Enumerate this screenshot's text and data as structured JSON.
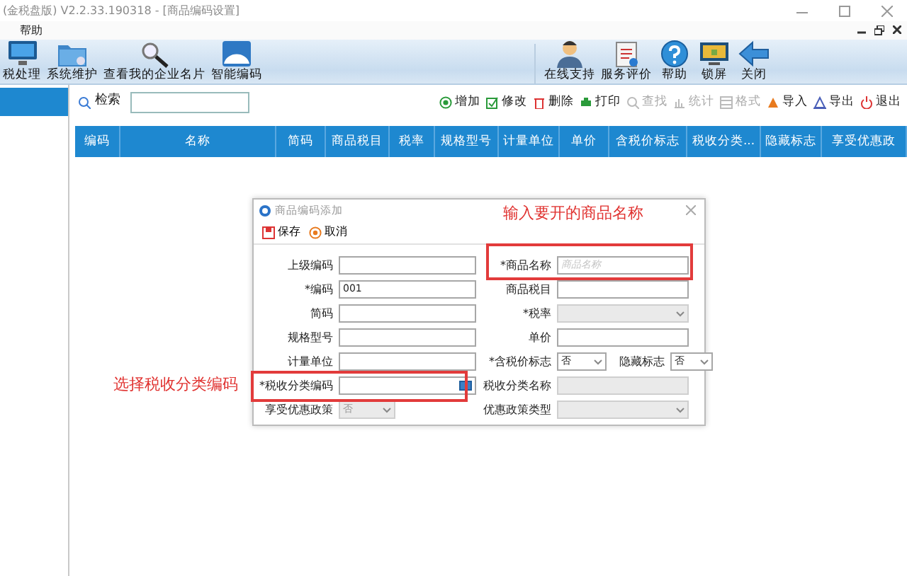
{
  "window": {
    "title": "(金税盘版)  V2.2.33.190318 - [商品编码设置]"
  },
  "menu": [
    "帮助"
  ],
  "toolbar": [
    {
      "label": "税处理"
    },
    {
      "label": "系统维护"
    },
    {
      "label": "查看我的企业名片"
    },
    {
      "label": "智能编码"
    },
    {
      "label": "在线支持"
    },
    {
      "label": "服务评价"
    },
    {
      "label": "帮助"
    },
    {
      "label": "锁屏"
    },
    {
      "label": "关闭"
    }
  ],
  "search": {
    "label": "检索"
  },
  "actions": [
    {
      "label": "增加",
      "disabled": false
    },
    {
      "label": "修改",
      "disabled": false
    },
    {
      "label": "删除",
      "disabled": false
    },
    {
      "label": "打印",
      "disabled": false
    },
    {
      "label": "查找",
      "disabled": true
    },
    {
      "label": "统计",
      "disabled": true
    },
    {
      "label": "格式",
      "disabled": true
    },
    {
      "label": "导入",
      "disabled": false
    },
    {
      "label": "导出",
      "disabled": false
    },
    {
      "label": "退出",
      "disabled": false
    }
  ],
  "table": {
    "columns": [
      "编码",
      "名称",
      "简码",
      "商品税目",
      "税率",
      "规格型号",
      "计量单位",
      "单价",
      "含税价标志",
      "税收分类...",
      "隐藏标志",
      "享受优惠政"
    ]
  },
  "dialog": {
    "title": "商品编码添加",
    "buttons": [
      "保存",
      "取消"
    ],
    "rows": [
      [
        {
          "label": "上级编码",
          "kind": "text",
          "disabled": false
        },
        {
          "label": "*商品名称",
          "kind": "text",
          "placeholder": "商品名称",
          "disabled": false
        }
      ],
      [
        {
          "label": "*编码",
          "kind": "text",
          "value": "001",
          "disabled": false
        },
        {
          "label": "商品税目",
          "kind": "text",
          "disabled": false
        }
      ],
      [
        {
          "label": "简码",
          "kind": "text",
          "disabled": false
        },
        {
          "label": "*税率",
          "kind": "select",
          "disabled": true
        }
      ],
      [
        {
          "label": "规格型号",
          "kind": "text",
          "disabled": false
        },
        {
          "label": "单价",
          "kind": "text",
          "disabled": false
        }
      ],
      [
        {
          "label": "计量单位",
          "kind": "text",
          "disabled": false
        },
        {
          "label": "*含税价标志",
          "kind": "select",
          "value": "否",
          "disabled": false
        },
        {
          "label": "隐藏标志",
          "kind": "select",
          "value": "否",
          "disabled": false
        }
      ],
      [
        {
          "label": "*税收分类编码",
          "kind": "browse",
          "disabled": false
        },
        {
          "label": "税收分类名称",
          "kind": "text",
          "disabled": true
        }
      ],
      [
        {
          "label": "享受优惠政策",
          "kind": "select",
          "value": "否",
          "disabled": true
        },
        {
          "label": "优惠政策类型",
          "kind": "select",
          "disabled": true
        }
      ]
    ]
  },
  "annotations": [
    {
      "text": "输入要开的商品名称"
    },
    {
      "text": "选择税收分类编码"
    }
  ]
}
